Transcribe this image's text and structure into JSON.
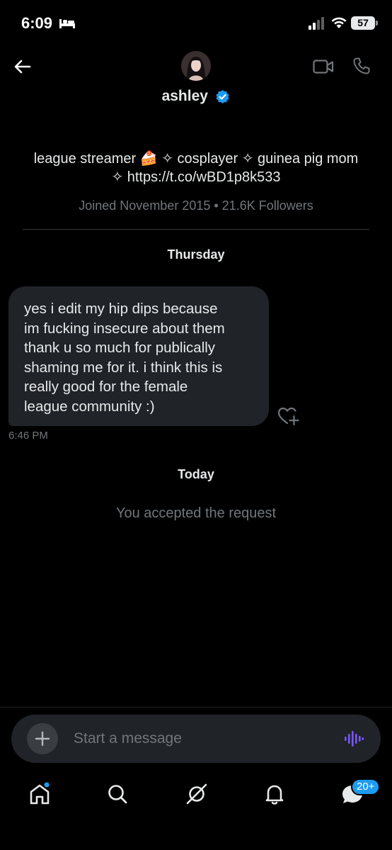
{
  "status_bar": {
    "time": "6:09",
    "battery": "57"
  },
  "header": {
    "name": "ashley"
  },
  "profile": {
    "bio_line1": "league streamer 🍰 ✧ cosplayer ✧ guinea pig mom",
    "bio_line2": "✧ https://t.co/wBD1p8k533",
    "joined": "Joined November 2015 • 21.6K Followers"
  },
  "conversation": {
    "day1": "Thursday",
    "messages": [
      {
        "lines": [
          "yes i edit my hip dips because",
          "im fucking insecure about them",
          "thank u so much for publically",
          "shaming me for it. i think this is",
          "really good for the female",
          "league community :)"
        ],
        "time": "6:46 PM"
      }
    ],
    "day2": "Today",
    "system_message": "You accepted the request"
  },
  "composer": {
    "placeholder": "Start a message"
  },
  "tabbar": {
    "messages_badge": "20+"
  },
  "colors": {
    "accent": "#1d9bf0",
    "voice": "#7856ff",
    "bubble": "#202327",
    "muted": "#71767b"
  }
}
